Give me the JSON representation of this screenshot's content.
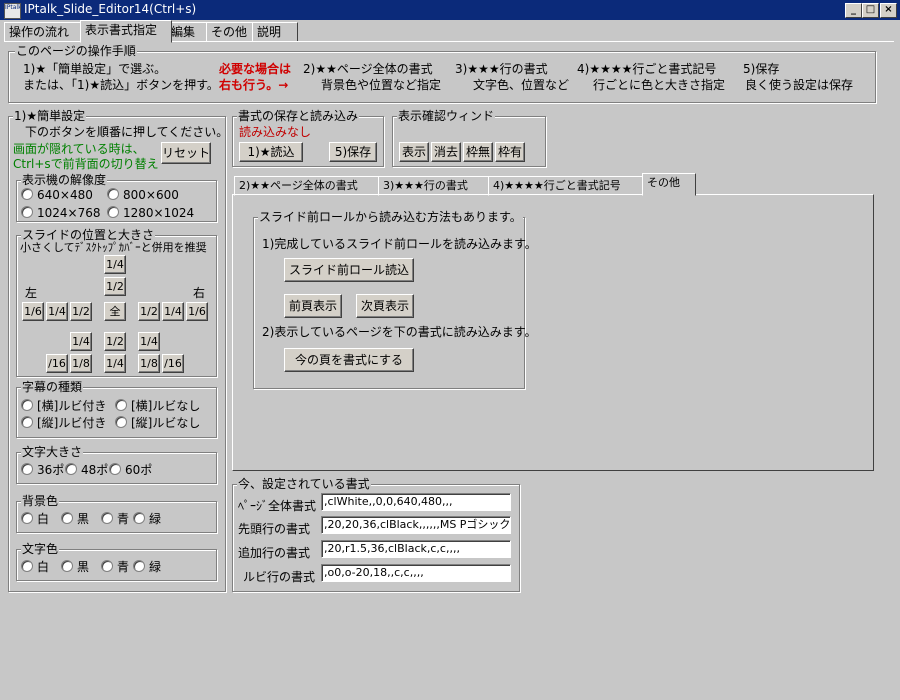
{
  "window": {
    "title": "IPtalk_Slide_Editor14(Ctrl+s)",
    "icon_text": "IPtalk",
    "minimize": "_",
    "maximize": "□",
    "close": "×"
  },
  "tabs": [
    "操作の流れ",
    "表示書式指定",
    "編集",
    "その他",
    "説明"
  ],
  "steps": {
    "title": "このページの操作手順",
    "line1a": "1)★「簡単設定」で選ぶ。",
    "line1b": "または、「1)★読込」ボタンを押す。",
    "required1": "必要な場合は",
    "required2": "右も行う。→",
    "s2a": "2)★★ページ全体の書式",
    "s2b": "背景色や位置など指定",
    "s3a": "3)★★★行の書式",
    "s3b": "文字色、位置など",
    "s4a": "4)★★★★行ごと書式記号",
    "s4b": "行ごとに色と大きさ指定",
    "s5a": "5)保存",
    "s5b": "良く使う設定は保存"
  },
  "easy": {
    "title": "1)★簡単設定",
    "hint": "下のボタンを順番に押してください。",
    "green1": "画面が隠れている時は、",
    "green2": "Ctrl+sで前背面の切り替え",
    "reset": "リセット",
    "resolution": {
      "title": "表示機の解像度",
      "options": [
        "640×480",
        "800×600",
        "1024×768",
        "1280×1024"
      ]
    },
    "slide": {
      "title": "スライドの位置と大きさ",
      "note": "小さくしてﾃﾞｽｸﾄｯﾌﾟｶﾊﾞｰと併用を推奨",
      "left": "左",
      "right": "右",
      "b_top1": "1/4",
      "b_top2": "1/2",
      "b_l1": "1/6",
      "b_l2": "1/4",
      "b_l3": "1/2",
      "b_all": "全",
      "b_r1": "1/2",
      "b_r2": "1/4",
      "b_r3": "1/6",
      "b_d1": "1/4",
      "b_d2": "1/2",
      "b_d3": "1/4",
      "b_e1": "/16",
      "b_e2": "1/8",
      "b_e3": "1/4",
      "b_e4": "1/8",
      "b_e5": "/16"
    },
    "subtitle_type": {
      "title": "字幕の種類",
      "options": [
        "[横]ルビ付き",
        "[横]ルビなし",
        "[縦]ルビ付き",
        "[縦]ルビなし"
      ]
    },
    "font_size": {
      "title": "文字大きさ",
      "options": [
        "36ポ",
        "48ポ",
        "60ポ"
      ]
    },
    "bg_color": {
      "title": "背景色",
      "options": [
        "白",
        "黒",
        "青",
        "緑"
      ]
    },
    "text_color": {
      "title": "文字色",
      "options": [
        "白",
        "黒",
        "青",
        "緑"
      ]
    }
  },
  "saveload": {
    "title": "書式の保存と読み込み",
    "status": "読み込みなし",
    "load": "1)★読込",
    "save": "5)保存"
  },
  "preview": {
    "title": "表示確認ウィンド",
    "show": "表示",
    "erase": "消去",
    "noframe": "枠無",
    "frame": "枠有"
  },
  "subtabs": [
    "2)★★ページ全体の書式",
    "3)★★★行の書式",
    "4)★★★★行ごと書式記号",
    "その他"
  ],
  "other": {
    "group_title": "スライド前ロールから読み込む方法もあります。",
    "line1": "1)完成しているスライド前ロールを読み込みます。",
    "load_btn": "スライド前ロール読込",
    "prev": "前頁表示",
    "next": "次頁表示",
    "line2": "2)表示しているページを下の書式に読み込みます。",
    "apply": "今の頁を書式にする"
  },
  "current": {
    "title": "今、設定されている書式",
    "rows": [
      {
        "label": "ﾍﾟｰｼﾞ全体書式",
        "value": ",clWhite,,0,0,640,480,,,"
      },
      {
        "label": "先頭行の書式",
        "value": ",20,20,36,clBlack,,,,,,MS Pゴシック"
      },
      {
        "label": "追加行の書式",
        "value": ",20,r1.5,36,clBlack,c,c,,,,"
      },
      {
        "label": "ルビ行の書式",
        "value": ",o0,o-20,18,,c,c,,,,"
      }
    ]
  }
}
